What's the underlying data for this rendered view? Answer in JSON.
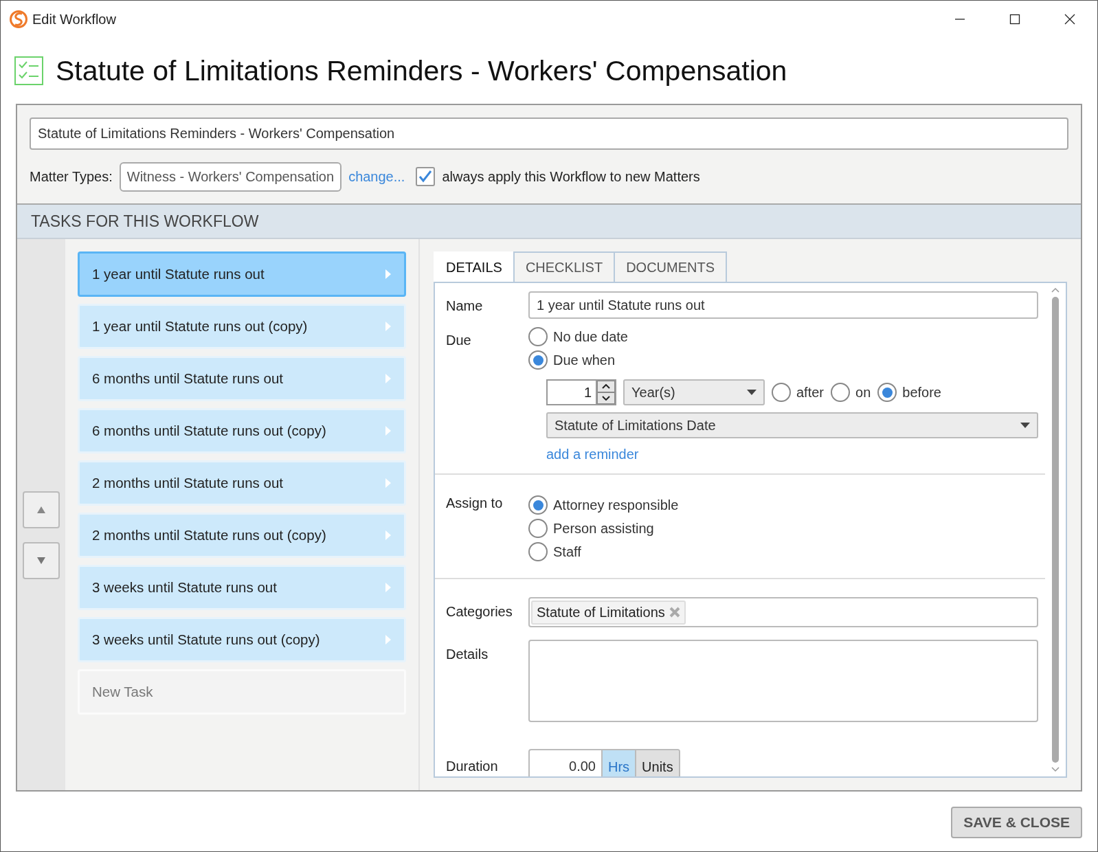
{
  "window": {
    "title": "Edit Workflow"
  },
  "heading": "Statute of Limitations Reminders - Workers' Compensation",
  "workflow_name": {
    "value": "Statute of Limitations Reminders - Workers' Compensation"
  },
  "matter_types": {
    "label": "Matter Types:",
    "value": "Witness - Workers' Compensation",
    "change_link": "change...",
    "always_apply": {
      "label": "always apply this Workflow to new Matters",
      "checked": true
    }
  },
  "tasks_header": "TASKS FOR THIS WORKFLOW",
  "tasks": [
    {
      "kind": "task",
      "label": "1 year until Statute runs out",
      "selected": true
    },
    {
      "kind": "task",
      "label": "1 year until Statute runs out (copy)",
      "selected": false
    },
    {
      "kind": "task",
      "label": "6 months until Statute runs out",
      "selected": false
    },
    {
      "kind": "task",
      "label": "6 months until Statute runs out (copy)",
      "selected": false
    },
    {
      "kind": "task",
      "label": "2 months until Statute runs out",
      "selected": false
    },
    {
      "kind": "task",
      "label": "2 months until Statute runs out (copy)",
      "selected": false
    },
    {
      "kind": "task",
      "label": "3 weeks until Statute runs out",
      "selected": false
    },
    {
      "kind": "task",
      "label": "3 weeks until Statute runs out (copy)",
      "selected": false
    },
    {
      "kind": "new",
      "label": "New Task",
      "selected": false
    }
  ],
  "tabs": [
    {
      "label": "DETAILS",
      "selected": true
    },
    {
      "label": "CHECKLIST",
      "selected": false
    },
    {
      "label": "DOCUMENTS",
      "selected": false
    }
  ],
  "details": {
    "name": {
      "label": "Name",
      "value": "1 year until Statute runs out"
    },
    "due": {
      "label": "Due",
      "options": [
        {
          "label": "No due date",
          "selected": false
        },
        {
          "label": "Due when",
          "selected": true
        }
      ],
      "amount": "1",
      "unit": "Year(s)",
      "relation": [
        {
          "label": "after",
          "selected": false
        },
        {
          "label": "on",
          "selected": false
        },
        {
          "label": "before",
          "selected": true
        }
      ],
      "date_field": "Statute of Limitations Date",
      "add_reminder": "add a reminder"
    },
    "assign": {
      "label": "Assign to",
      "options": [
        {
          "label": "Attorney responsible",
          "selected": true
        },
        {
          "label": "Person assisting",
          "selected": false
        },
        {
          "label": "Staff",
          "selected": false
        }
      ]
    },
    "categories": {
      "label": "Categories",
      "tags": [
        "Statute of Limitations"
      ]
    },
    "details_field": {
      "label": "Details"
    },
    "duration": {
      "label": "Duration",
      "value": "0.00",
      "units": [
        {
          "label": "Hrs",
          "selected": true
        },
        {
          "label": "Units",
          "selected": false
        }
      ]
    }
  },
  "save_button": "SAVE & CLOSE"
}
